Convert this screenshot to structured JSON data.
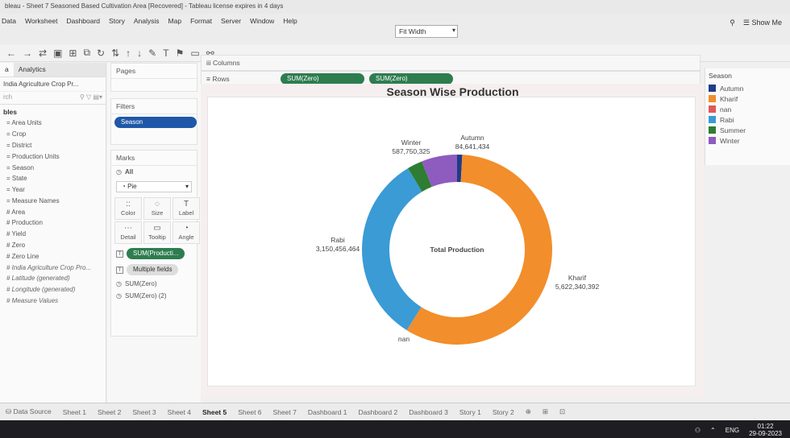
{
  "window": {
    "title": "bleau - Sheet 7 Seasoned Based Cultivation Area [Recovered] - Tableau license expires in 4 days"
  },
  "menu": [
    "Data",
    "Worksheet",
    "Dashboard",
    "Story",
    "Analysis",
    "Map",
    "Format",
    "Server",
    "Window",
    "Help"
  ],
  "toolbar": {
    "fit": "Fit Width",
    "show_me": "Show Me"
  },
  "datapane": {
    "tab_data": "a",
    "tab_analytics": "Analytics",
    "datasource": "India Agriculture Crop Pr...",
    "search_placeholder": "rch",
    "tables_header": "bles",
    "fields": [
      "Area Units",
      "Crop",
      "District",
      "Production Units",
      "Season",
      "State",
      "Year",
      "Measure Names",
      "Area",
      "Production",
      "Yield",
      "Zero",
      "Zero Line",
      "India Agriculture Crop Pro...",
      "Latitude (generated)",
      "Longitude (generated)",
      "Measure Values"
    ]
  },
  "pages": {
    "title": "Pages"
  },
  "filters": {
    "title": "Filters",
    "pill": "Season"
  },
  "marks": {
    "title": "Marks",
    "all": "All",
    "type": "Pie",
    "buttons": [
      {
        "icon": "::",
        "label": "Color"
      },
      {
        "icon": "◌",
        "label": "Size"
      },
      {
        "icon": "T",
        "label": "Label"
      },
      {
        "icon": "⋯",
        "label": "Detail"
      },
      {
        "icon": "▭",
        "label": "Tooltip"
      },
      {
        "icon": "◔",
        "label": "Angle"
      }
    ],
    "pill_1": "SUM(Producti...",
    "pill_2": "Multiple fields",
    "sub_1": "SUM(Zero)",
    "sub_2": "SUM(Zero) (2)"
  },
  "shelves": {
    "columns_label": "Columns",
    "rows_label": "Rows",
    "rows_pill_1": "SUM(Zero)",
    "rows_pill_2": "SUM(Zero)"
  },
  "legend": {
    "title": "Season",
    "items": [
      {
        "label": "Autumn",
        "color": "#1f3c88"
      },
      {
        "label": "Kharif",
        "color": "#f28e2b"
      },
      {
        "label": "nan",
        "color": "#e15759"
      },
      {
        "label": "Rabi",
        "color": "#3a9bd5"
      },
      {
        "label": "Summer",
        "color": "#2e7d32"
      },
      {
        "label": "Winter",
        "color": "#8e5bbf"
      }
    ]
  },
  "chart_data": {
    "type": "pie",
    "title": "Season Wise Production",
    "center_label": "Total Production",
    "categories": [
      "Autumn",
      "Kharif",
      "nan",
      "Rabi",
      "Summer",
      "Winter"
    ],
    "values": [
      84641434,
      5622340392,
      1000000,
      3150456464,
      250000000,
      587750325
    ],
    "labels": [
      {
        "name": "Autumn",
        "value": "84,641,434"
      },
      {
        "name": "Kharif",
        "value": "5,622,340,392"
      },
      {
        "name": "nan",
        "value": ""
      },
      {
        "name": "Rabi",
        "value": "3,150,456,464"
      },
      {
        "name": "Summer",
        "value": ""
      },
      {
        "name": "Winter",
        "value": "587,750,325"
      }
    ]
  },
  "sheets": {
    "datasource": "Data Source",
    "tabs": [
      "Sheet 1",
      "Sheet 2",
      "Sheet 3",
      "Sheet 4",
      "Sheet 5",
      "Sheet 6",
      "Sheet 7",
      "Dashboard 1",
      "Dashboard 2",
      "Dashboard 3",
      "Story 1",
      "Story 2"
    ],
    "active": "Sheet 5"
  },
  "taskbar": {
    "lang": "ENG",
    "time": "01:22",
    "date": "29-09-2023"
  }
}
